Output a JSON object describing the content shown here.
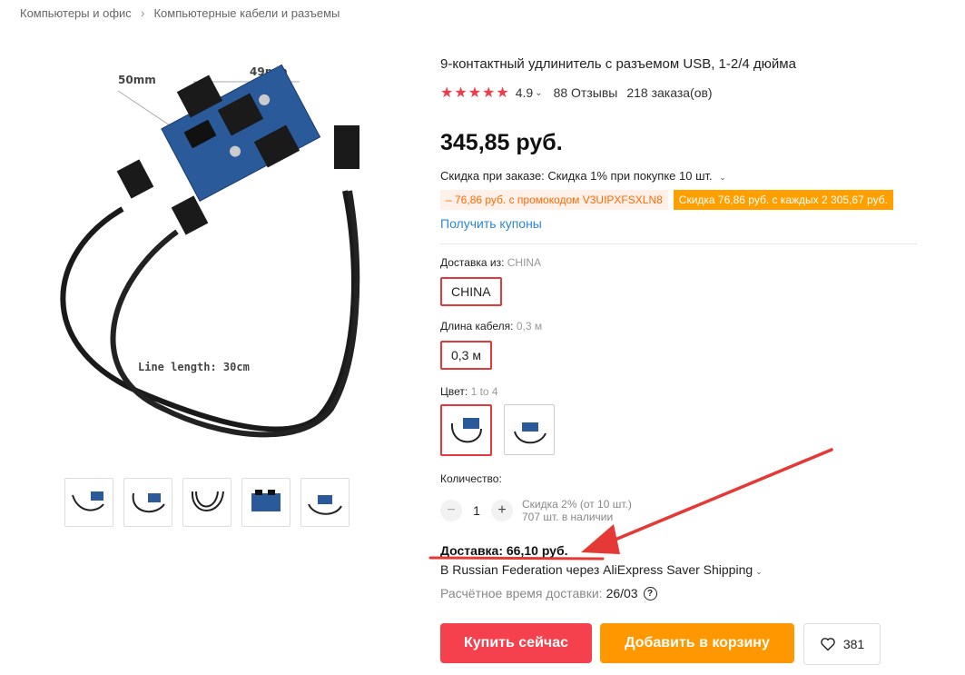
{
  "breadcrumb": {
    "items": [
      "Компьютеры и офис",
      "Компьютерные кабели и разъемы"
    ],
    "separator": ">"
  },
  "main_image": {
    "labels": {
      "width": "50mm",
      "depth": "49mm",
      "line_length": "Line length: 30cm"
    }
  },
  "product": {
    "title": "9-контактный удлинитель с разъемом USB, 1-2/4 дюйма",
    "rating": "4.9",
    "rating_stars": 5,
    "reviews": "88 Отзывы",
    "orders": "218 заказа(ов)",
    "price": "345,85 руб.",
    "discount_label": "Скидка при заказе:",
    "discount_text": "Скидка 1% при покупке 10 шт.",
    "promo_code_text": "– 76,86 руб. с промокодом V3UIPXFSXLN8",
    "promo_store_text": "Скидка 76,86 руб. с каждых 2 305,67 руб.",
    "coupons_link": "Получить купоны"
  },
  "options": {
    "ship_from": {
      "label": "Доставка из:",
      "value": "CHINA",
      "option": "CHINA"
    },
    "cable_length": {
      "label": "Длина кабеля:",
      "value": "0,3 м",
      "option": "0,3 м"
    },
    "color": {
      "label": "Цвет:",
      "value": "1 to 4"
    }
  },
  "quantity": {
    "label": "Количество:",
    "value": "1",
    "minus": "−",
    "plus": "+",
    "bulk_discount": "Скидка 2% (от 10 шт.)",
    "stock": "707 шт. в наличии"
  },
  "shipping": {
    "title": "Доставка: 66,10 руб.",
    "method": "В Russian Federation через AliExpress Saver Shipping",
    "eta_label": "Расчётное время доставки:",
    "eta_date": "26/03",
    "help": "?"
  },
  "actions": {
    "buy_now": "Купить сейчас",
    "add_to_cart": "Добавить в корзину",
    "wishlist_count": "381"
  },
  "colors": {
    "accent_red": "#f5414e",
    "accent_orange": "#ff9800",
    "link_blue": "#2a87d9",
    "star_red": "#f23a4a",
    "annotation_red": "#e53935"
  },
  "icons": [
    "chevron-right-icon",
    "star-icon",
    "chevron-down-icon",
    "help-icon",
    "heart-icon"
  ]
}
